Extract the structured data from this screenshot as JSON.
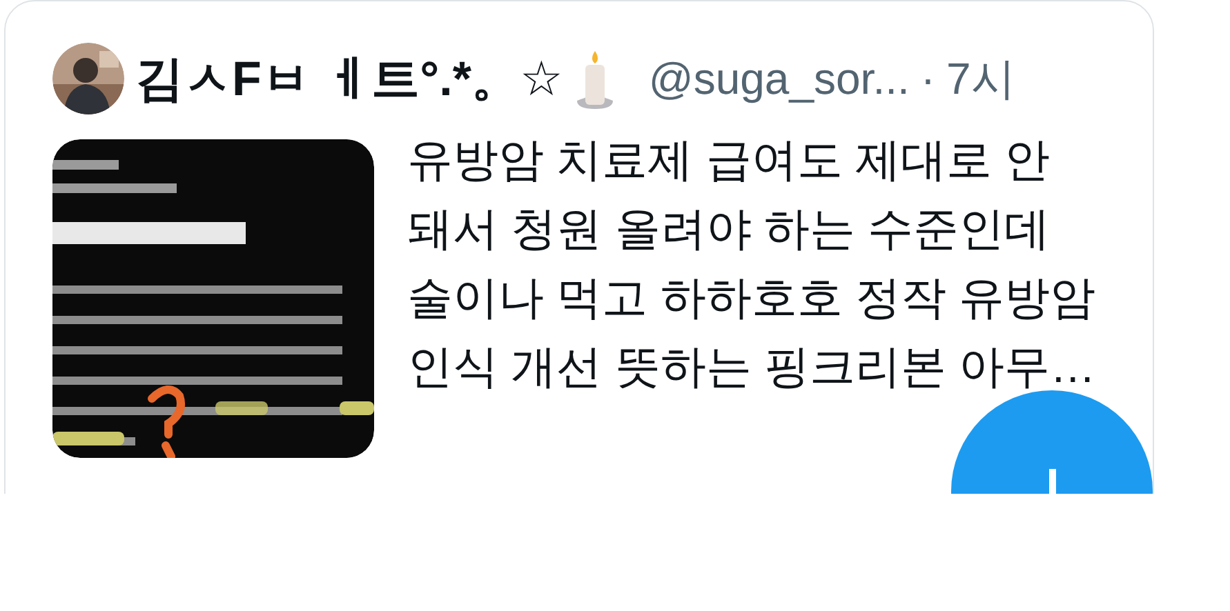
{
  "tweet": {
    "author_name": "김ㅅFㅂ ㅔ트°.*。☆",
    "handle": "@suga_sor...",
    "separator": "·",
    "time": "7시",
    "text": "유방암 치료제 급여도 제대로 안\n돼서 청원 올려야 하는 수준인데\n술이나 먹고 하하호호 정작 유방암\n인식 개선 뜻하는 핑크리본 아무…"
  }
}
